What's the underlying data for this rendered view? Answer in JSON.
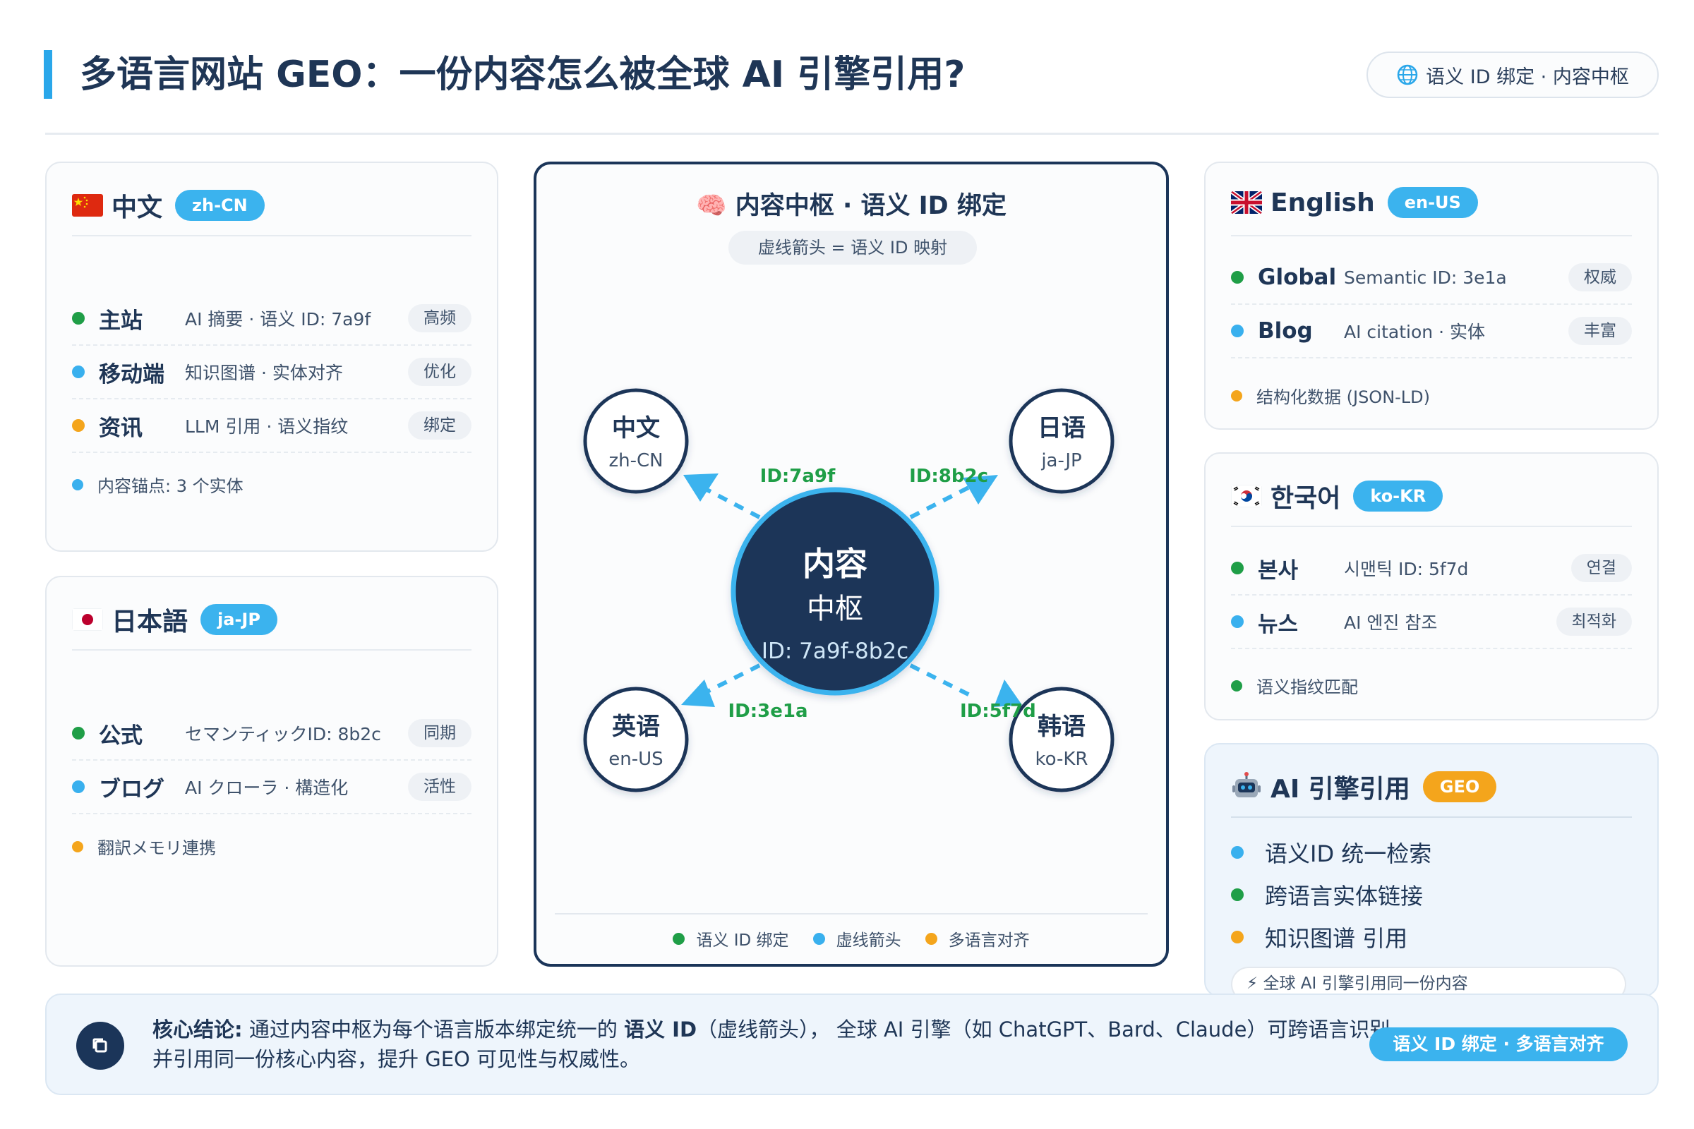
{
  "header": {
    "title": "多语言网站 GEO：一份内容怎么被全球 AI 引擎引用?",
    "pill": "语义 ID 绑定 · 内容中枢"
  },
  "zh_card": {
    "title": "中文",
    "tag": "zh-CN",
    "rows": [
      {
        "name": "主站",
        "desc": "AI 摘要 · 语义 ID: 7a9f",
        "chip": "高频"
      },
      {
        "name": "移动端",
        "desc": "知识图谱 · 实体对齐",
        "chip": "优化"
      },
      {
        "name": "资讯",
        "desc": "LLM 引用 · 语义指纹",
        "chip": "绑定"
      }
    ],
    "note": "内容锚点: 3 个实体"
  },
  "ja_card": {
    "title": "日本語",
    "tag": "ja-JP",
    "rows": [
      {
        "name": "公式",
        "desc": "セマンティックID: 8b2c",
        "chip": "同期"
      },
      {
        "name": "ブログ",
        "desc": "AI クローラ · 構造化",
        "chip": "活性"
      }
    ],
    "note": "翻訳メモリ連携"
  },
  "hub": {
    "title": "🧠 内容中枢 · 语义 ID 绑定",
    "subtitle": "虚线箭头 = 语义 ID 映射",
    "core_line1": "内容",
    "core_line2": "中枢",
    "core_id": "ID: 7a9f-8b2c",
    "nodes": [
      {
        "name": "中文",
        "code": "zh-CN"
      },
      {
        "name": "日语",
        "code": "ja-JP"
      },
      {
        "name": "英语",
        "code": "en-US"
      },
      {
        "name": "韩语",
        "code": "ko-KR"
      }
    ],
    "edge_labels": [
      "ID:7a9f",
      "ID:8b2c",
      "ID:3e1a",
      "ID:5f7d"
    ],
    "legend": [
      "语义 ID 绑定",
      "虚线箭头",
      "多语言对齐"
    ]
  },
  "en_card": {
    "title": "English",
    "tag": "en-US",
    "rows": [
      {
        "name": "Global",
        "desc": "Semantic ID: 3e1a",
        "chip": "权威"
      },
      {
        "name": "Blog",
        "desc": "AI citation · 实体",
        "chip": "丰富"
      }
    ],
    "note": "结构化数据 (JSON-LD)"
  },
  "ko_card": {
    "title": "한국어",
    "tag": "ko-KR",
    "rows": [
      {
        "name": "본사",
        "desc": "시맨틱 ID: 5f7d",
        "chip": "연결"
      },
      {
        "name": "뉴스",
        "desc": "AI 엔진 참조",
        "chip": "최적화"
      }
    ],
    "note": "语义指纹匹配"
  },
  "ai_card": {
    "title": "AI 引擎引用",
    "tag": "GEO",
    "items": [
      "语义ID 统一检索",
      "跨语言实体链接",
      "知识图谱 引用"
    ],
    "footer": "⚡ 全球 AI 引擎引用同一份内容"
  },
  "conclusion": {
    "label": "核心结论:",
    "text_a": "通过内容中枢为每个语言版本绑定统一的",
    "highlight": "语义 ID",
    "text_b": "（虚线箭头），  全球 AI 引擎（如 ChatGPT、Bard、Claude）可跨语言识别并引用同一份核心内容，提升 GEO 可见性与权威性。",
    "pill": "语义 ID 绑定 · 多语言对齐"
  },
  "colors": {
    "navy": "#1b3559",
    "accent_blue": "#3bb3ee",
    "green": "#1f9e47",
    "orange": "#f4a51c"
  }
}
